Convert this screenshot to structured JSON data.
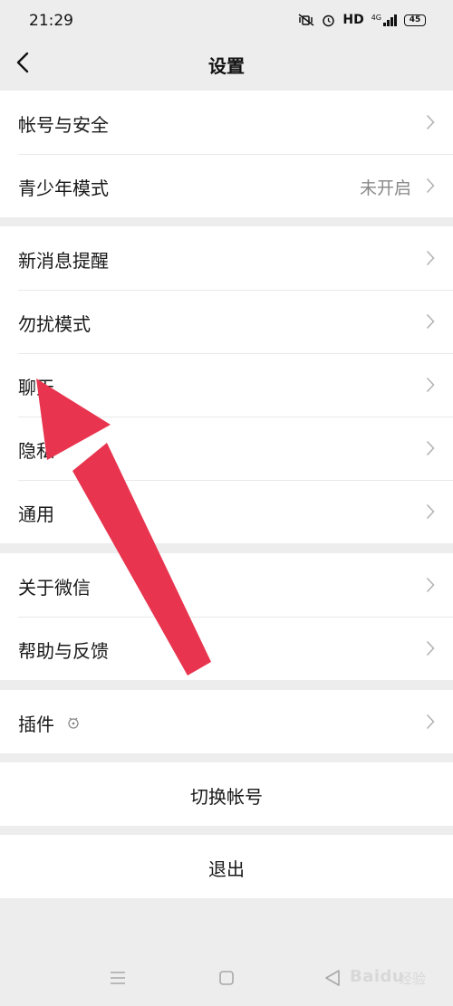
{
  "status_bar": {
    "time": "21:29",
    "network": "HD",
    "signal_label": "4G",
    "battery": "45"
  },
  "header": {
    "title": "设置"
  },
  "groups": {
    "account": {
      "items": [
        {
          "label": "帐号与安全"
        },
        {
          "label": "青少年模式",
          "value": "未开启"
        }
      ]
    },
    "preferences": {
      "items": [
        {
          "label": "新消息提醒"
        },
        {
          "label": "勿扰模式"
        },
        {
          "label": "聊天"
        },
        {
          "label": "隐私"
        },
        {
          "label": "通用"
        }
      ]
    },
    "about": {
      "items": [
        {
          "label": "关于微信"
        },
        {
          "label": "帮助与反馈"
        }
      ]
    },
    "plugins": {
      "items": [
        {
          "label": "插件"
        }
      ]
    }
  },
  "actions": {
    "switch_account": "切换帐号",
    "logout": "退出"
  },
  "watermark": {
    "brand": "Baidu",
    "sub": "经验"
  },
  "colors": {
    "background": "#ededed",
    "cell": "#ffffff",
    "arrow": "#e8344e",
    "secondary_text": "#888888"
  }
}
